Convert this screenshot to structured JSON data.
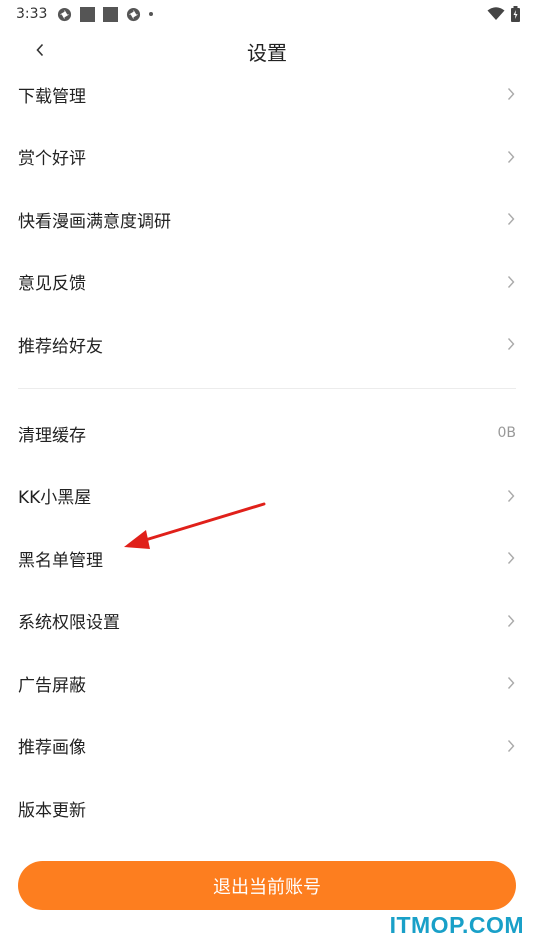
{
  "status_bar": {
    "time": "3:33",
    "icons": [
      "pinwheel-icon",
      "square-icon",
      "square-icon",
      "pinwheel-icon",
      "dot-icon"
    ],
    "right_icons": [
      "wifi-icon",
      "battery-icon"
    ]
  },
  "header": {
    "title": "设置",
    "back_icon": "chevron-left-icon"
  },
  "group1": [
    {
      "label": "下载管理"
    },
    {
      "label": "赏个好评"
    },
    {
      "label": "快看漫画满意度调研"
    },
    {
      "label": "意见反馈"
    },
    {
      "label": "推荐给好友"
    }
  ],
  "group2": [
    {
      "label": "清理缓存",
      "value": "0B"
    },
    {
      "label": "KK小黑屋"
    },
    {
      "label": "黑名单管理"
    },
    {
      "label": "系统权限设置"
    },
    {
      "label": "广告屏蔽"
    },
    {
      "label": "推荐画像"
    },
    {
      "label": "版本更新"
    }
  ],
  "logout_button": "退出当前账号",
  "annotation": {
    "color": "#e0201a",
    "target": "黑名单管理"
  },
  "watermark": "ITMOP.COM",
  "colors": {
    "accent": "#fd7e1f",
    "watermark": "#19a0c8"
  }
}
